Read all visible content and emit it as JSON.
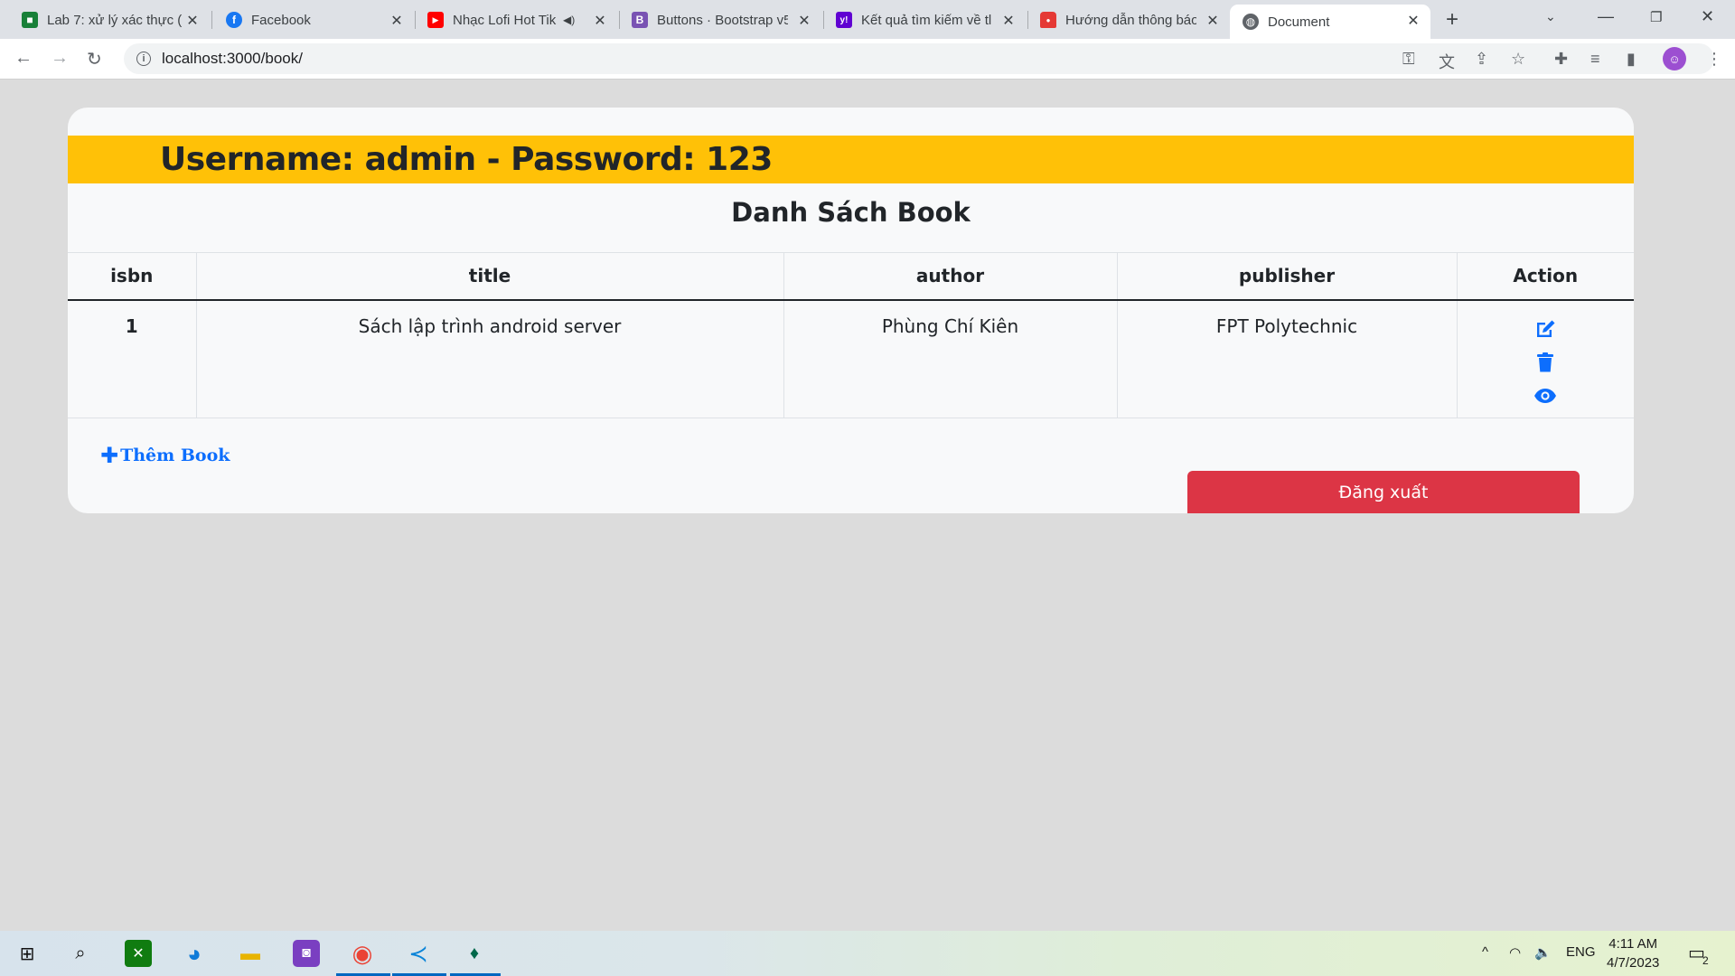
{
  "browser": {
    "tabs": [
      {
        "label": "Lab 7: xử lý xác thực (",
        "favicon_color": "#188038",
        "favicon_glyph": "■",
        "icon": "sheets-icon"
      },
      {
        "label": "Facebook",
        "favicon_color": "#1877f2",
        "favicon_glyph": "f",
        "icon": "facebook-icon"
      },
      {
        "label": "Nhạc Lofi Hot Tik",
        "favicon_color": "#ff0000",
        "favicon_glyph": "▶",
        "icon": "youtube-icon",
        "audio": "◀)"
      },
      {
        "label": "Buttons · Bootstrap v5",
        "favicon_color": "#7952b3",
        "favicon_glyph": "B",
        "icon": "bootstrap-icon"
      },
      {
        "label": "Kết quả tìm kiếm về tl",
        "favicon_color": "#6001d2",
        "favicon_glyph": "y!",
        "icon": "yahoo-icon"
      },
      {
        "label": "Hướng dẫn thông báo",
        "favicon_color": "#e53935",
        "favicon_glyph": "●",
        "icon": "shopping-bag-icon"
      },
      {
        "label": "Document",
        "favicon_color": "#5f6368",
        "favicon_glyph": "◍",
        "icon": "globe-icon"
      }
    ],
    "url": "localhost:3000/book/"
  },
  "page": {
    "banner": "Username: admin - Password: 123",
    "list_title": "Danh Sách Book",
    "table": {
      "headers": [
        "isbn",
        "title",
        "author",
        "publisher",
        "Action"
      ],
      "rows": [
        {
          "isbn": "1",
          "title": "Sách lập trình android server",
          "author": "Phùng Chí Kiên",
          "publisher": "FPT Polytechnic"
        }
      ]
    },
    "add_link": "Thêm Book",
    "logout_button": "Đăng xuất",
    "colors": {
      "banner": "#ffc107",
      "action_icons": "#0d6efd",
      "logout": "#dc3545"
    }
  },
  "taskbar": {
    "language": "ENG",
    "time": "4:11 AM",
    "date": "4/7/2023",
    "notification_count": "2"
  }
}
